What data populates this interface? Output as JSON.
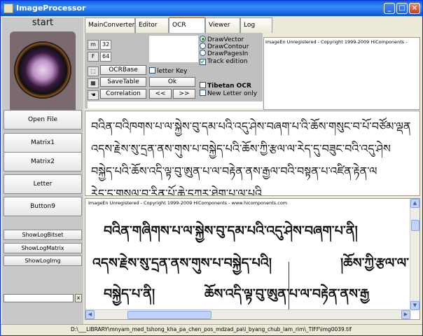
{
  "window": {
    "title": "ImageProcessor"
  },
  "left": {
    "start_label": "start",
    "buttons": [
      "Open File",
      "Matrix1",
      "Matrix2",
      "Letter",
      "Button9"
    ],
    "small_buttons": [
      "ShowLogBitset",
      "ShowLogMatrix",
      "ShowLogImg"
    ],
    "clear_label": "x"
  },
  "tabs": [
    "MainConverter",
    "Editor",
    "OCR",
    "Viewer",
    "Log"
  ],
  "active_tab": "OCR",
  "ocr": {
    "icon_m": "m",
    "value_32": "32",
    "label_f": "F",
    "value_64": "64",
    "ocrbase": "OCRBase",
    "savetable": "SaveTable",
    "correlation": "Correlation",
    "letter_key": "letter Key",
    "ok": "Ok",
    "prev": "<<",
    "next": ">>",
    "radio_draw_vector": "DrawVector",
    "radio_draw_contour": "DrawContour",
    "radio_draw_pages": "DrawPagesIn",
    "track_edition": "Track edition",
    "tibetan_ocr": "Tibetan OCR",
    "new_letter_only": "New Letter only"
  },
  "copyright_text": "ImageEn Unregistered - Copyright 1999-2009 HiComponents - www.hicomponents.com",
  "copyright_text_short": "ImageEn Unregistered - Copyright 1999-2009 HiComponents - ",
  "ocr_text_lines": [
    "བའིན་བའིཁགས་པ་ལ་སྐྱེས་བུ་དམ་པའི་འདུ་ཤེས་བཞག་པ་འི་ཆོས་གསུང་བ་པོ་བཙོམ་ལྡན",
    "འདས་རྗེས་སུ་དྲན་ནས་གུས་པ་བསྐྱེད་པའི་ཆོས་ཀྱི་རྩལ་ལ་རེད་དུ་བཟུང་བའི་འདུ་ཤེས",
    "བསྐྱེད་པའི་ཆོས་འདི་ལྟ་བུ་ཨུན་པ་ལ་བརྟེན་ནས་རྒྱལ་བའི་བསྟན་པ་འཛིན་རྟེན་ལ",
    "རེད་དུ་གསལ་བ་རིན་པོ་ཆེ་དཀར་ཐེག་པ་ལ་པའི"
  ],
  "image_text_lines": [
    "བའིན་གཞིགས་པ་ལ་སྐྱེས་བུ་དམ་པའི་འདུ་ཤེས་བཞག་པ་ནི།",
    "འདས་རྗེས་སུ་དྲན་ནས་གུས་པ་བསྐྱེད་པའི།",
    "།ཆོས་ཀྱི་རྩལ་ལ་",
    "བསྐྱེད་པ་ནི།",
    "ཆོས་འདི་ལྟ་བུ་ཨུན་པ་ལ་བརྟེན་ནས་རྒྱ"
  ],
  "status": {
    "path": "D:\\___LIBRARY\\mnyam_med_tshong_kha_pa_chen_pos_mdzad_pa\\l_byang_chub_lam_rim\\_TIFF\\img0039.tif"
  }
}
